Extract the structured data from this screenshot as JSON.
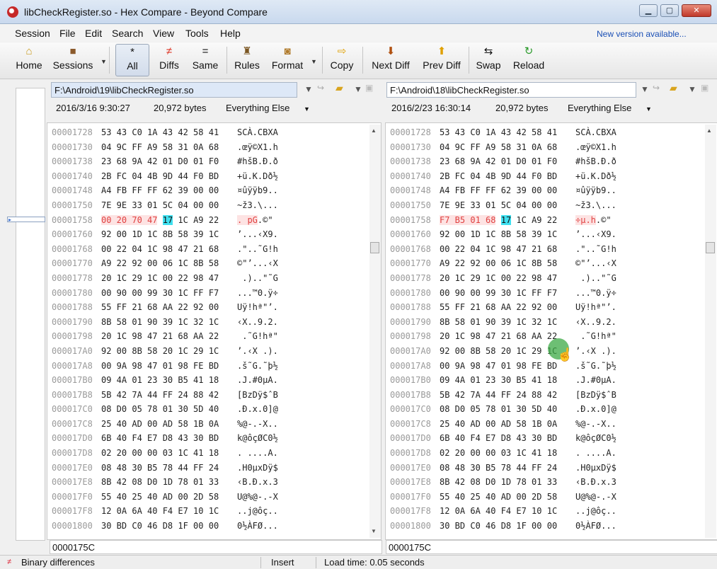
{
  "window": {
    "title": "libCheckRegister.so - Hex Compare - Beyond Compare"
  },
  "menu": {
    "items": [
      "Session",
      "File",
      "Edit",
      "Search",
      "View",
      "Tools",
      "Help"
    ],
    "new_version": "New version available..."
  },
  "toolbar": {
    "home": "Home",
    "sessions": "Sessions",
    "all": "All",
    "diffs": "Diffs",
    "same": "Same",
    "rules": "Rules",
    "format": "Format",
    "copy": "Copy",
    "next_diff": "Next Diff",
    "prev_diff": "Prev Diff",
    "swap": "Swap",
    "reload": "Reload"
  },
  "left": {
    "path": "F:\\Android\\19\\libCheckRegister.so",
    "timestamp": "2016/3/16 9:30:27",
    "size": "20,972 bytes",
    "format": "Everything Else",
    "address": "0000175C",
    "rows": [
      {
        "addr": "00001728",
        "bytes": "53 43 C0 1A 43 42 58 41",
        "ascii": "SCÀ.CBXA"
      },
      {
        "addr": "00001730",
        "bytes": "04 9C FF A9 58 31 0A 68",
        "ascii": ".œÿ©X1.h"
      },
      {
        "addr": "00001738",
        "bytes": "23 68 9A 42 01 D0 01 F0",
        "ascii": "#hšB.Ð.ð"
      },
      {
        "addr": "00001740",
        "bytes": "2B FC 04 4B 9D 44 F0 BD",
        "ascii": "+ü.K.Dð½"
      },
      {
        "addr": "00001748",
        "bytes": "A4 FB FF FF 62 39 00 00",
        "ascii": "¤ûÿÿb9.."
      },
      {
        "addr": "00001750",
        "bytes": "7E 9E 33 01 5C 04 00 00",
        "ascii": "~ž3.\\..."
      },
      {
        "addr": "00001758",
        "bytes_pre": "00 20 70 47",
        "bytes_post": " 17 1C A9 22",
        "ascii_pre": ". pG",
        "ascii_post": ".©\""
      },
      {
        "addr": "00001760",
        "bytes": "92 00 1D 1C 8B 58 39 1C",
        "ascii": "’...‹X9."
      },
      {
        "addr": "00001768",
        "bytes": "00 22 04 1C 98 47 21 68",
        "ascii": ".\"..˜G!h"
      },
      {
        "addr": "00001770",
        "bytes": "A9 22 92 00 06 1C 8B 58",
        "ascii": "©\"’...‹X"
      },
      {
        "addr": "00001778",
        "bytes": "20 1C 29 1C 00 22 98 47",
        "ascii": " .)..\"˜G"
      },
      {
        "addr": "00001780",
        "bytes": "00 90 00 99 30 1C FF F7",
        "ascii": "...™0.ÿ÷"
      },
      {
        "addr": "00001788",
        "bytes": "55 FF 21 68 AA 22 92 00",
        "ascii": "Uÿ!hª\"’."
      },
      {
        "addr": "00001790",
        "bytes": "8B 58 01 90 39 1C 32 1C",
        "ascii": "‹X..9.2."
      },
      {
        "addr": "00001798",
        "bytes": "20 1C 98 47 21 68 AA 22",
        "ascii": " .˜G!hª\""
      },
      {
        "addr": "000017A0",
        "bytes": "92 00 8B 58 20 1C 29 1C",
        "ascii": "’.‹X .)."
      },
      {
        "addr": "000017A8",
        "bytes": "00 9A 98 47 01 98 FE BD",
        "ascii": ".š˜G.˜þ½"
      },
      {
        "addr": "000017B0",
        "bytes": "09 4A 01 23 30 B5 41 18",
        "ascii": ".J.#0µA."
      },
      {
        "addr": "000017B8",
        "bytes": "5B 42 7A 44 FF 24 88 42",
        "ascii": "[BzDÿ$ˆB"
      },
      {
        "addr": "000017C0",
        "bytes": "08 D0 05 78 01 30 5D 40",
        "ascii": ".Ð.x.0]@"
      },
      {
        "addr": "000017C8",
        "bytes": "25 40 AD 00 AD 58 1B 0A",
        "ascii": "%@-.-X.."
      },
      {
        "addr": "000017D0",
        "bytes": "6B 40 F4 E7 D8 43 30 BD",
        "ascii": "k@ôçØC0½"
      },
      {
        "addr": "000017D8",
        "bytes": "02 20 00 00 03 1C 41 18",
        "ascii": ". ....A."
      },
      {
        "addr": "000017E0",
        "bytes": "08 48 30 B5 78 44 FF 24",
        "ascii": ".H0µxDÿ$"
      },
      {
        "addr": "000017E8",
        "bytes": "8B 42 08 D0 1D 78 01 33",
        "ascii": "‹B.Ð.x.3"
      },
      {
        "addr": "000017F0",
        "bytes": "55 40 25 40 AD 00 2D 58",
        "ascii": "U@%@-.-X"
      },
      {
        "addr": "000017F8",
        "bytes": "12 0A 6A 40 F4 E7 10 1C",
        "ascii": "..j@ôç.."
      },
      {
        "addr": "00001800",
        "bytes": "30 BD C0 46 D8 1F 00 00",
        "ascii": "0½ÀFØ..."
      }
    ]
  },
  "right": {
    "path": "F:\\Android\\18\\libCheckRegister.so",
    "timestamp": "2016/2/23 16:30:14",
    "size": "20,972 bytes",
    "format": "Everything Else",
    "address": "0000175C",
    "rows": [
      {
        "addr": "00001728",
        "bytes": "53 43 C0 1A 43 42 58 41",
        "ascii": "SCÀ.CBXA"
      },
      {
        "addr": "00001730",
        "bytes": "04 9C FF A9 58 31 0A 68",
        "ascii": ".œÿ©X1.h"
      },
      {
        "addr": "00001738",
        "bytes": "23 68 9A 42 01 D0 01 F0",
        "ascii": "#hšB.Ð.ð"
      },
      {
        "addr": "00001740",
        "bytes": "2B FC 04 4B 9D 44 F0 BD",
        "ascii": "+ü.K.Dð½"
      },
      {
        "addr": "00001748",
        "bytes": "A4 FB FF FF 62 39 00 00",
        "ascii": "¤ûÿÿb9.."
      },
      {
        "addr": "00001750",
        "bytes": "7E 9E 33 01 5C 04 00 00",
        "ascii": "~ž3.\\..."
      },
      {
        "addr": "00001758",
        "bytes_pre": "F7 B5 01 68",
        "bytes_post": " 17 1C A9 22",
        "ascii_pre": "÷µ.h",
        "ascii_post": ".©\""
      },
      {
        "addr": "00001760",
        "bytes": "92 00 1D 1C 8B 58 39 1C",
        "ascii": "’...‹X9."
      },
      {
        "addr": "00001768",
        "bytes": "00 22 04 1C 98 47 21 68",
        "ascii": ".\"..˜G!h"
      },
      {
        "addr": "00001770",
        "bytes": "A9 22 92 00 06 1C 8B 58",
        "ascii": "©\"’...‹X"
      },
      {
        "addr": "00001778",
        "bytes": "20 1C 29 1C 00 22 98 47",
        "ascii": " .)..\"˜G"
      },
      {
        "addr": "00001780",
        "bytes": "00 90 00 99 30 1C FF F7",
        "ascii": "...™0.ÿ÷"
      },
      {
        "addr": "00001788",
        "bytes": "55 FF 21 68 AA 22 92 00",
        "ascii": "Uÿ!hª\"’."
      },
      {
        "addr": "00001790",
        "bytes": "8B 58 01 90 39 1C 32 1C",
        "ascii": "‹X..9.2."
      },
      {
        "addr": "00001798",
        "bytes": "20 1C 98 47 21 68 AA 22",
        "ascii": " .˜G!hª\""
      },
      {
        "addr": "000017A0",
        "bytes": "92 00 8B 58 20 1C 29 1C",
        "ascii": "’.‹X .)."
      },
      {
        "addr": "000017A8",
        "bytes": "00 9A 98 47 01 98 FE BD",
        "ascii": ".š˜G.˜þ½"
      },
      {
        "addr": "000017B0",
        "bytes": "09 4A 01 23 30 B5 41 18",
        "ascii": ".J.#0µA."
      },
      {
        "addr": "000017B8",
        "bytes": "5B 42 7A 44 FF 24 88 42",
        "ascii": "[BzDÿ$ˆB"
      },
      {
        "addr": "000017C0",
        "bytes": "08 D0 05 78 01 30 5D 40",
        "ascii": ".Ð.x.0]@"
      },
      {
        "addr": "000017C8",
        "bytes": "25 40 AD 00 AD 58 1B 0A",
        "ascii": "%@-.-X.."
      },
      {
        "addr": "000017D0",
        "bytes": "6B 40 F4 E7 D8 43 30 BD",
        "ascii": "k@ôçØC0½"
      },
      {
        "addr": "000017D8",
        "bytes": "02 20 00 00 03 1C 41 18",
        "ascii": ". ....A."
      },
      {
        "addr": "000017E0",
        "bytes": "08 48 30 B5 78 44 FF 24",
        "ascii": ".H0µxDÿ$"
      },
      {
        "addr": "000017E8",
        "bytes": "8B 42 08 D0 1D 78 01 33",
        "ascii": "‹B.Ð.x.3"
      },
      {
        "addr": "000017F0",
        "bytes": "55 40 25 40 AD 00 2D 58",
        "ascii": "U@%@-.-X"
      },
      {
        "addr": "000017F8",
        "bytes": "12 0A 6A 40 F4 E7 10 1C",
        "ascii": "..j@ôç.."
      },
      {
        "addr": "00001800",
        "bytes": "30 BD C0 46 D8 1F 00 00",
        "ascii": "0½ÀFØ..."
      }
    ]
  },
  "status": {
    "text": "Binary differences",
    "mode": "Insert",
    "load_time": "Load time: 0.05 seconds"
  },
  "colors": {
    "diff_bg": "#fde3e3",
    "diff_fg": "#e04040",
    "cursor": "#3fe0f0"
  }
}
